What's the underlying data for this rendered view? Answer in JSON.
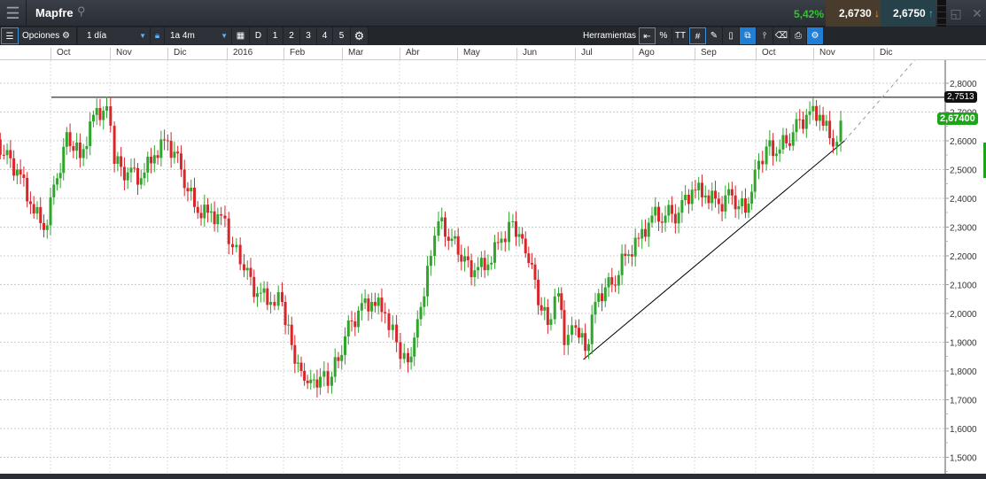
{
  "header": {
    "title": "Mapfre",
    "change": "5,42%",
    "sell": "2,6730",
    "buy": "2,6750"
  },
  "toolbar": {
    "options": "Opciones",
    "interval": "1 día",
    "range": "1a 4m",
    "periods": [
      "D",
      "1",
      "2",
      "3",
      "4",
      "5"
    ],
    "tools": "Herramientas",
    "percent": "%",
    "text": "TT"
  },
  "price_labels": {
    "line": "2,7513",
    "last": "2,67400"
  },
  "colors": {
    "up": "#2fa52c",
    "down": "#d8262b",
    "last": "#1da51a"
  },
  "chart_data": {
    "type": "candlestick",
    "x_tick_labels": [
      "Oct",
      "Nov",
      "Dic",
      "2016",
      "Feb",
      "Mar",
      "Abr",
      "May",
      "Jun",
      "Jul",
      "Ago",
      "Sep",
      "Oct",
      "Nov",
      "Dic"
    ],
    "y_tick_labels": [
      "2,8000",
      "2,7000",
      "2,6000",
      "2,5000",
      "2,4000",
      "2,3000",
      "2,2000",
      "2,1000",
      "2,0000",
      "1,9000",
      "1,8000",
      "1,7000",
      "1,6000",
      "1,5000"
    ],
    "ylim": [
      1.5,
      2.8
    ],
    "grid": true,
    "points": [
      [
        "2015-09-06",
        2.55
      ],
      [
        "2015-09-13",
        2.5
      ],
      [
        "2015-09-20",
        2.38
      ],
      [
        "2015-09-27",
        2.29
      ],
      [
        "2015-10-04",
        2.47
      ],
      [
        "2015-10-09",
        2.63
      ],
      [
        "2015-10-16",
        2.54
      ],
      [
        "2015-10-23",
        2.69
      ],
      [
        "2015-10-30",
        2.72
      ],
      [
        "2015-11-03",
        2.52
      ],
      [
        "2015-11-10",
        2.49
      ],
      [
        "2015-11-17",
        2.47
      ],
      [
        "2015-11-24",
        2.55
      ],
      [
        "2015-12-01",
        2.6
      ],
      [
        "2015-12-08",
        2.5
      ],
      [
        "2015-12-15",
        2.37
      ],
      [
        "2015-12-22",
        2.35
      ],
      [
        "2015-12-29",
        2.34
      ],
      [
        "2016-01-04",
        2.23
      ],
      [
        "2016-01-10",
        2.15
      ],
      [
        "2016-01-17",
        2.07
      ],
      [
        "2016-01-24",
        2.04
      ],
      [
        "2016-01-30",
        2.04
      ],
      [
        "2016-02-04",
        1.89
      ],
      [
        "2016-02-09",
        1.8
      ],
      [
        "2016-02-14",
        1.77
      ],
      [
        "2016-02-19",
        1.78
      ],
      [
        "2016-02-25",
        1.78
      ],
      [
        "2016-03-03",
        1.92
      ],
      [
        "2016-03-10",
        2.01
      ],
      [
        "2016-03-17",
        2.04
      ],
      [
        "2016-03-24",
        2.0
      ],
      [
        "2016-03-30",
        1.9
      ],
      [
        "2016-04-05",
        1.83
      ],
      [
        "2016-04-10",
        1.98
      ],
      [
        "2016-04-17",
        2.2
      ],
      [
        "2016-04-21",
        2.32
      ],
      [
        "2016-04-28",
        2.26
      ],
      [
        "2016-05-03",
        2.18
      ],
      [
        "2016-05-10",
        2.15
      ],
      [
        "2016-05-17",
        2.17
      ],
      [
        "2016-05-24",
        2.26
      ],
      [
        "2016-05-30",
        2.32
      ],
      [
        "2016-06-04",
        2.26
      ],
      [
        "2016-06-09",
        2.17
      ],
      [
        "2016-06-14",
        2.01
      ],
      [
        "2016-06-19",
        1.98
      ],
      [
        "2016-06-23",
        2.07
      ],
      [
        "2016-06-26",
        1.89
      ],
      [
        "2016-07-02",
        1.95
      ],
      [
        "2016-07-07",
        1.87
      ],
      [
        "2016-07-14",
        2.07
      ],
      [
        "2016-07-21",
        2.1
      ],
      [
        "2016-07-28",
        2.2
      ],
      [
        "2016-08-04",
        2.26
      ],
      [
        "2016-08-11",
        2.34
      ],
      [
        "2016-08-18",
        2.34
      ],
      [
        "2016-08-25",
        2.35
      ],
      [
        "2016-09-01",
        2.43
      ],
      [
        "2016-09-08",
        2.41
      ],
      [
        "2016-09-15",
        2.38
      ],
      [
        "2016-09-22",
        2.41
      ],
      [
        "2016-09-29",
        2.35
      ],
      [
        "2016-10-04",
        2.5
      ],
      [
        "2016-10-10",
        2.58
      ],
      [
        "2016-10-17",
        2.57
      ],
      [
        "2016-10-24",
        2.63
      ],
      [
        "2016-10-31",
        2.69
      ],
      [
        "2016-11-07",
        2.69
      ],
      [
        "2016-11-14",
        2.58
      ],
      [
        "2016-11-18",
        2.67
      ]
    ],
    "horizontal_line": 2.7513,
    "trend_line": {
      "from": [
        "2016-07-06",
        1.84
      ],
      "to": [
        "2016-11-20",
        2.6
      ],
      "extended_to": [
        "2016-12-28",
        2.89
      ]
    }
  }
}
